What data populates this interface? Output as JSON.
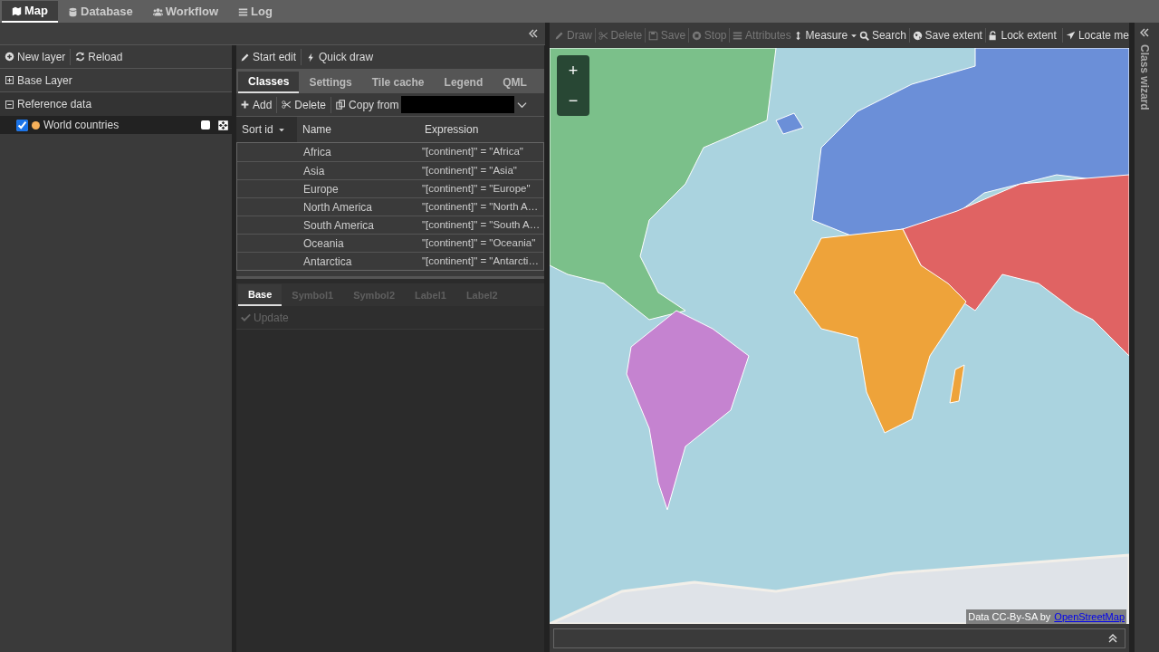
{
  "top_tabs": [
    {
      "label": "Map",
      "selected": true
    },
    {
      "label": "Database",
      "selected": false
    },
    {
      "label": "Workflow",
      "selected": false
    },
    {
      "label": "Log",
      "selected": false
    }
  ],
  "layer_toolbar": [
    "New layer",
    "Reload"
  ],
  "tree": [
    {
      "label": "Base Layer",
      "expanded": false
    },
    {
      "label": "Reference data",
      "expanded": true,
      "children": [
        {
          "label": "World countries",
          "checked": true,
          "color": "#f5b05a"
        }
      ]
    }
  ],
  "edit_toolbar": [
    "Start edit",
    "Quick draw"
  ],
  "layer_tabs": [
    {
      "label": "Classes",
      "selected": true
    },
    {
      "label": "Settings",
      "selected": false
    },
    {
      "label": "Tile cache",
      "selected": false
    },
    {
      "label": "Legend",
      "selected": false
    },
    {
      "label": "QML",
      "selected": false
    }
  ],
  "class_toolbar": {
    "buttons": [
      "Add",
      "Delete"
    ],
    "copy_from": "Copy from"
  },
  "table": {
    "columns": [
      {
        "label": "Sort id",
        "sorted": true
      },
      {
        "label": "Name",
        "sorted": false
      },
      {
        "label": "Expression",
        "sorted": false
      }
    ],
    "rows": [
      {
        "name": "Africa",
        "expression": "\"[continent]\" = \"Africa\""
      },
      {
        "name": "Asia",
        "expression": "\"[continent]\" = \"Asia\""
      },
      {
        "name": "Europe",
        "expression": "\"[continent]\" = \"Europe\""
      },
      {
        "name": "North America",
        "expression": "\"[continent]\" = \"North A…"
      },
      {
        "name": "South America",
        "expression": "\"[continent]\" = \"South A…"
      },
      {
        "name": "Oceania",
        "expression": "\"[continent]\" = \"Oceania\""
      },
      {
        "name": "Antarctica",
        "expression": "\"[continent]\" = \"Antarcti…"
      }
    ]
  },
  "style_tabs": [
    {
      "label": "Base",
      "selected": true,
      "disabled": false
    },
    {
      "label": "Symbol1",
      "selected": false,
      "disabled": true
    },
    {
      "label": "Symbol2",
      "selected": false,
      "disabled": true
    },
    {
      "label": "Label1",
      "selected": false,
      "disabled": true
    },
    {
      "label": "Label2",
      "selected": false,
      "disabled": true
    }
  ],
  "update_button": {
    "label": "Update",
    "disabled": true
  },
  "map_toolbar": [
    {
      "label": "Draw",
      "disabled": true
    },
    {
      "label": "Delete",
      "disabled": true
    },
    {
      "label": "Save",
      "disabled": true
    },
    {
      "label": "Stop",
      "disabled": true
    },
    {
      "label": "Attributes",
      "disabled": true
    },
    {
      "label": "Measure",
      "disabled": false
    },
    {
      "label": "Search",
      "disabled": false
    },
    {
      "label": "Save extent",
      "disabled": false
    },
    {
      "label": "Lock extent",
      "disabled": false
    },
    {
      "label": "Locate me",
      "disabled": false
    }
  ],
  "zoom": {
    "in": "+",
    "out": "−"
  },
  "attribution": {
    "text": "Data CC-By-SA by",
    "link": "OpenStreetMap"
  },
  "side_tab": "Class wizard"
}
